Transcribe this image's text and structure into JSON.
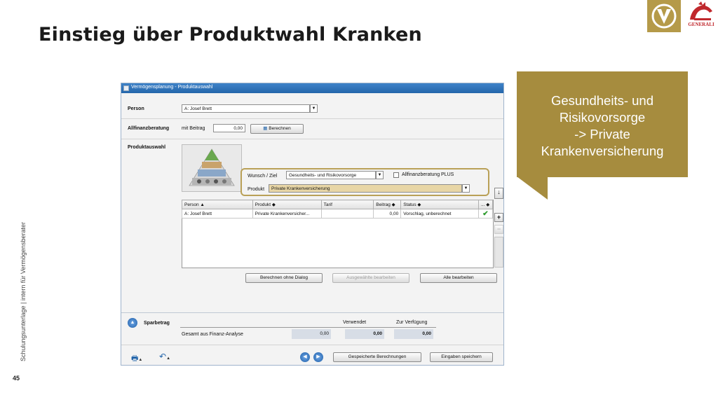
{
  "slide": {
    "title": "Einstieg über Produktwahl Kranken",
    "side_text": "Schulungsunterlage | intern für Vermögensberater",
    "page_number": "45",
    "logo_generali_text": "GENERALI"
  },
  "callout": {
    "lines": [
      "Gesundheits- und",
      "Risikovorsorge",
      "-> Private",
      "Krankenversicherung"
    ]
  },
  "window": {
    "title": "Vermögensplanung - Produktauswahl",
    "person_label": "Person",
    "person_value": "A: Josef Brett",
    "allfinanz_label": "Allfinanzberatung",
    "mit_beitrag_label": "mit Beitrag",
    "beitrag_value": "0,00",
    "berechnen_label": "Berechnen",
    "produktauswahl_label": "Produktauswahl",
    "wunsch_label": "Wunsch / Ziel",
    "wunsch_value": "Gesundheits- und Risikovorsorge",
    "allfinanz_plus_label": "Allfinanzberatung PLUS",
    "produkt_label": "Produkt",
    "produkt_value": "Private Krankenversicherung",
    "table": {
      "headers": [
        "Person ▲",
        "Produkt ◆",
        "Tarif",
        "Beitrag ◆",
        "Status ◆",
        "... ◆"
      ],
      "rows": [
        {
          "person": "A: Josef Brett",
          "produkt": "Private Krankenversicher...",
          "tarif": "",
          "beitrag": "0,00",
          "status": "Vorschlag, unberechnet",
          "check": "✔"
        }
      ]
    },
    "buttons": {
      "berechnen_ohne_dialog": "Berechnen ohne Dialog",
      "ausgewaehlte_bearbeiten": "Ausgewählte bearbeiten",
      "alle_bearbeiten": "Alle bearbeiten",
      "gespeicherte_berechnungen": "Gespeicherte Berechnungen",
      "eingaben_speichern": "Eingaben speichern"
    },
    "summary": {
      "sparbetrag_label": "Sparbetrag",
      "verwendet_label": "Verwendet",
      "zur_verfuegung_label": "Zur Verfügung",
      "gesamt_label": "Gesamt aus Finanz-Analyse",
      "gesamt_value": "0,00",
      "verwendet_value": "0,00",
      "zur_verfuegung_value": "0,00"
    }
  },
  "colors": {
    "brand_gold": "#a68c3e",
    "titlebar_blue": "#2466ab",
    "generali_red": "#c0282d"
  }
}
